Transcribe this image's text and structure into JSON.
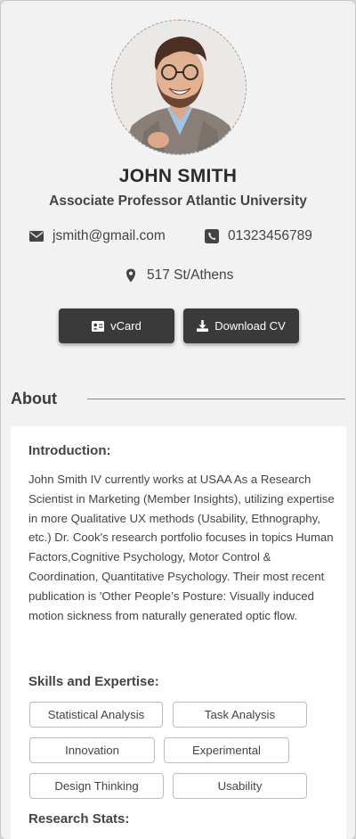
{
  "profile": {
    "name": "JOHN SMITH",
    "title": "Associate Professor Atlantic University",
    "email": "jsmith@gmail.com",
    "phone": "01323456789",
    "location": "517 St/Athens"
  },
  "actions": {
    "vcard_label": "vCard",
    "download_cv_label": "Download CV"
  },
  "about": {
    "heading": "About",
    "introduction_heading": "Introduction:",
    "introduction_text": "John Smith IV currently works at USAA As a Research Scientist in Marketing (Member Insights), utilizing expertise in more Qualitative UX methods (Usability, Ethnography, etc.) Dr. Cook's research portfolio focuses in topics Human Factors,Cognitive Psychology, Motor Control & Coordination, Quantitative Psychology. Their most recent publication is 'Other People’s Posture: Visually induced motion sickness from naturally generated optic flow.",
    "skills_heading": "Skills and Expertise:",
    "skills": [
      "Statistical Analysis",
      "Task Analysis",
      "Innovation",
      "Experimental",
      "Design Thinking",
      "Usability"
    ],
    "stats_heading": "Research Stats:"
  },
  "icons": {
    "email": "envelope-icon",
    "phone": "phone-icon",
    "location": "map-pin-icon",
    "vcard": "id-card-icon",
    "download": "download-icon"
  },
  "colors": {
    "button_bg": "#3a3a3a",
    "card_bg": "#f2f2f2"
  }
}
